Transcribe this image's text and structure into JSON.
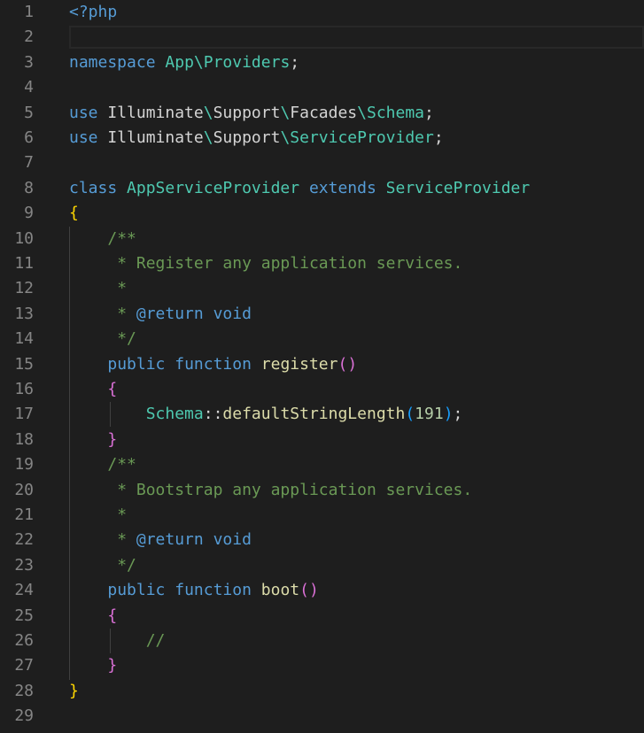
{
  "editor": {
    "lines": [
      "<?php",
      "",
      "namespace App\\Providers;",
      "",
      "use Illuminate\\Support\\Facades\\Schema;",
      "use Illuminate\\Support\\ServiceProvider;",
      "",
      "class AppServiceProvider extends ServiceProvider",
      "{",
      "    /**",
      "     * Register any application services.",
      "     *",
      "     * @return void",
      "     */",
      "    public function register()",
      "    {",
      "        Schema::defaultStringLength(191);",
      "    }",
      "    /**",
      "     * Bootstrap any application services.",
      "     *",
      "     * @return void",
      "     */",
      "    public function boot()",
      "    {",
      "        //",
      "    }",
      "}",
      ""
    ],
    "line_numbers": [
      "1",
      "2",
      "3",
      "4",
      "5",
      "6",
      "7",
      "8",
      "9",
      "10",
      "11",
      "12",
      "13",
      "14",
      "15",
      "16",
      "17",
      "18",
      "19",
      "20",
      "21",
      "22",
      "23",
      "24",
      "25",
      "26",
      "27",
      "28",
      "29"
    ],
    "tokens": {
      "php_open": "<?php",
      "namespace_kw": "namespace",
      "namespace_app": "App",
      "namespace_sep": "\\",
      "namespace_providers": "Providers",
      "semicolon": ";",
      "use_kw": "use",
      "illuminate": "Illuminate",
      "support": "Support",
      "facades": "Facades",
      "schema": "Schema",
      "service_provider": "ServiceProvider",
      "class_kw": "class",
      "class_name": "AppServiceProvider",
      "extends_kw": "extends",
      "open_brace": "{",
      "close_brace": "}",
      "doc_open": "/**",
      "doc_star": "*",
      "doc_close": "*/",
      "register_desc": "Register any application services.",
      "boot_desc": "Bootstrap any application services.",
      "at_return": "@return",
      "void": "void",
      "public_kw": "public",
      "function_kw": "function",
      "register_fn": "register",
      "boot_fn": "boot",
      "parens_open": "(",
      "parens_close": ")",
      "double_colon": "::",
      "default_string_length": "defaultStringLength",
      "num_191": "191",
      "line_comment": "//"
    }
  },
  "colors": {
    "background": "#1e1e1e",
    "keyword": "#569cd6",
    "class": "#4ec9b0",
    "function": "#dcdcaa",
    "comment": "#6a9955",
    "number": "#b5cea8",
    "bracket_gold": "#ffd700",
    "bracket_magenta": "#da70d6",
    "line_number": "#858585"
  }
}
